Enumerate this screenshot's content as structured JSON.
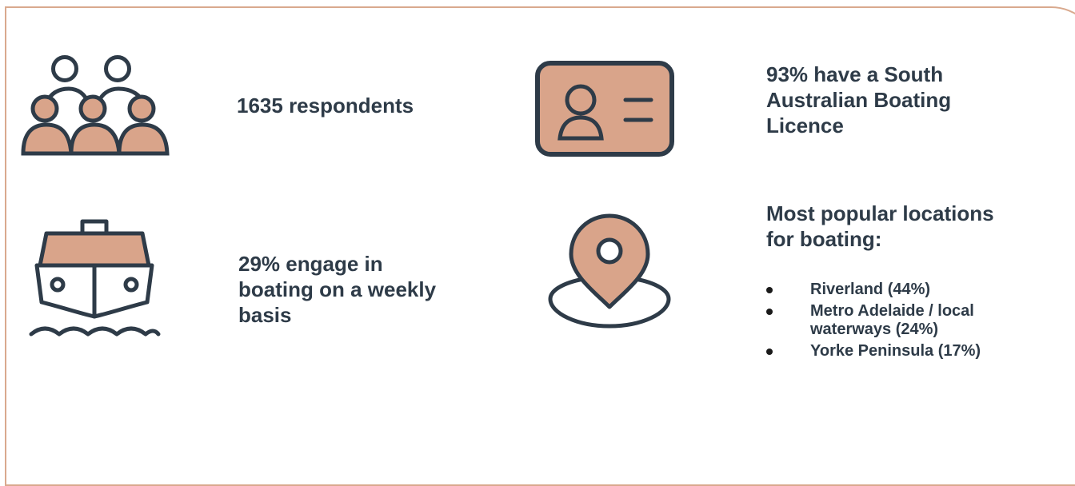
{
  "colors": {
    "accent_fill": "#d9a48a",
    "icon_stroke": "#2e3b48",
    "text": "#2e3b48",
    "border": "#d9a98e"
  },
  "stats": {
    "respondents": {
      "icon": "people-group-icon",
      "text": "1635 respondents"
    },
    "licence": {
      "icon": "id-card-icon",
      "line1": "93% have a South",
      "line2": "Australian Boating",
      "line3": "Licence"
    },
    "weekly": {
      "icon": "boat-icon",
      "line1": "29% engage in",
      "line2": "boating on a weekly",
      "line3": "basis"
    },
    "locations": {
      "icon": "location-pin-icon",
      "heading1": "Most popular locations",
      "heading2": "for boating:",
      "items": [
        {
          "line1": "Riverland (44%)"
        },
        {
          "line1": "Metro Adelaide / local",
          "line2": "waterways (24%)"
        },
        {
          "line1": "Yorke Peninsula (17%)"
        }
      ]
    }
  }
}
